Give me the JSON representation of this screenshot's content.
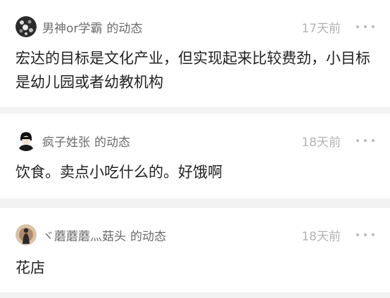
{
  "feed": {
    "items": [
      {
        "username": "男神or学霸",
        "action": "的动态",
        "time": "17天前",
        "content": "宏达的目标是文化产业，但实现起来比较费劲，小目标是幼儿园或者幼教机构",
        "avatar_icon": "patterned-avatar-icon",
        "avatar_color": "#2b2b2b"
      },
      {
        "username": "疯子姓张",
        "action": "的动态",
        "time": "18天前",
        "content": "饮食。卖点小吃什么的。好饿啊",
        "avatar_icon": "person-avatar-icon",
        "avatar_color": "#111111"
      },
      {
        "username": "ヾ蘑蘑蘑灬菇头",
        "action": "的动态",
        "time": "18天前",
        "content": "花店",
        "avatar_icon": "silhouette-avatar-icon",
        "avatar_color": "#b08a6a"
      }
    ]
  }
}
